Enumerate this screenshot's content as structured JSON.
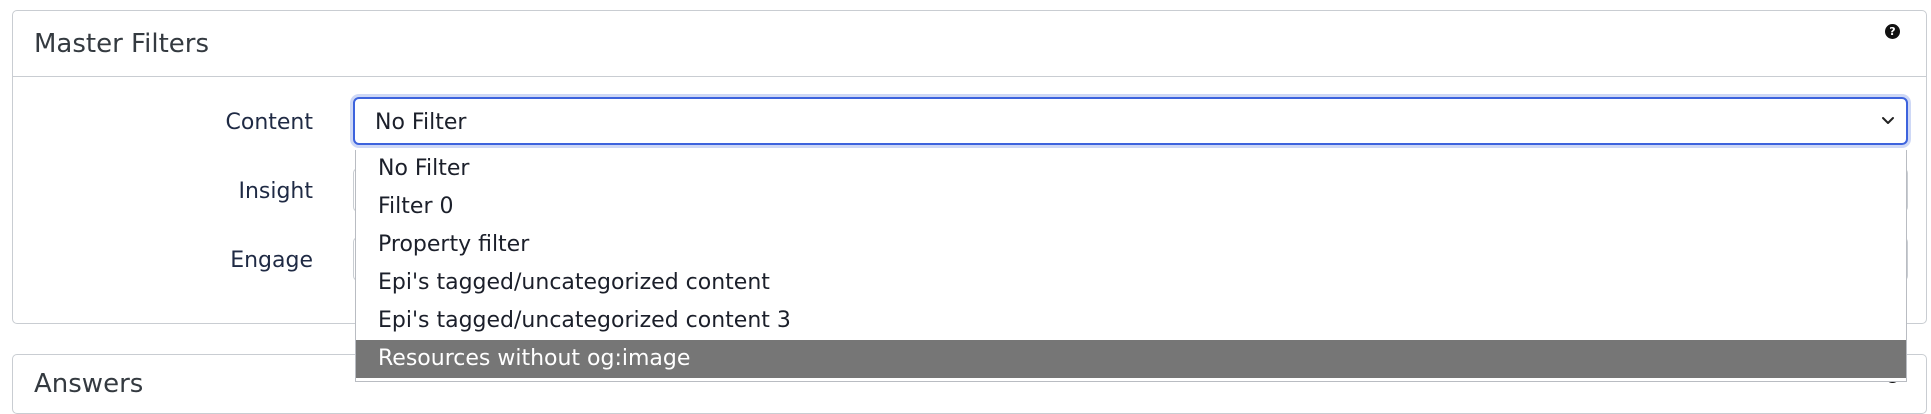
{
  "master_filters": {
    "title": "Master Filters",
    "help_icon": "question-circle-icon",
    "rows": [
      {
        "label": "Content",
        "value": "No Filter"
      },
      {
        "label": "Insight"
      },
      {
        "label": "Engage"
      }
    ],
    "dropdown": {
      "options": [
        "No Filter",
        "Filter 0",
        "Property filter",
        "Epi's tagged/uncategorized content",
        "Epi's tagged/uncategorized content 3",
        "Resources without og:image"
      ],
      "highlighted_index": 5
    }
  },
  "answers": {
    "title": "Answers"
  },
  "colors": {
    "focus_border": "#3d63dd",
    "highlight_bg": "#767676",
    "panel_border": "#c9cdd2"
  }
}
